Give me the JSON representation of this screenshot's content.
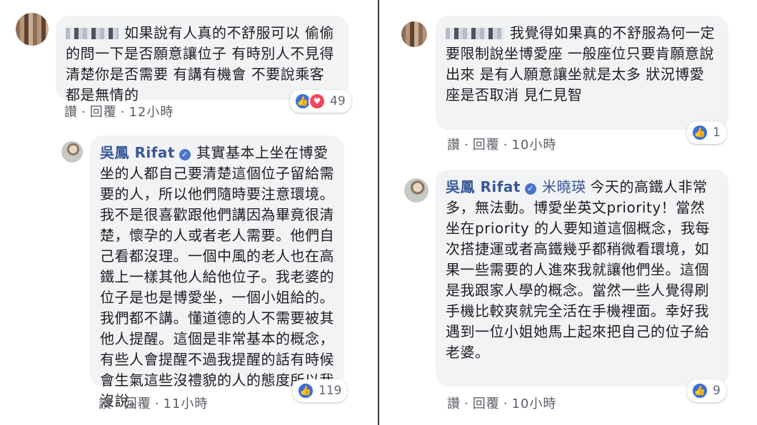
{
  "left_top": {
    "text": "如果說有人真的不舒服可以 偷偷的問一下是否願意讓位子 有時別人不見得清楚你是否需要 有講有機會 不要說乘客都是無情的",
    "like_label": "讚",
    "reply_label": "回覆",
    "time": "12小時",
    "reaction_count": "49",
    "reaction_icons": [
      "like-icon",
      "love-icon"
    ]
  },
  "left_reply": {
    "author": "吳鳳 Rifat",
    "text": "其實基本上坐在博愛坐的人都自己要清楚這個位子留給需要的人，所以他們隨時要注意環境。我不是很喜歡跟他們講因為畢竟很清楚，懷孕的人或者老人需要。他們自己看都沒理。一個中風的老人也在高鐵上一樣其他人給他位子。我老婆的位子是也是博愛坐，一個小姐給的。我們都不講。懂道德的人不需要被其他人提醒。這個是非常基本的概念，有些人會提醒不過我提醒的話有時候會生氣這些沒禮貌的人的態度所以我沒說。",
    "like_label": "讚",
    "reply_label": "回覆",
    "time": "11小時",
    "reaction_count": "119"
  },
  "right_top": {
    "text": "我覺得如果真的不舒服為何一定要限制說坐博愛座 一般座位只要肯願意說出來 是有人願意讓坐就是太多 狀況博愛座是否取消 見仁見智",
    "like_label": "讚",
    "reply_label": "回覆",
    "time": "10小時",
    "reaction_count": "1"
  },
  "right_reply": {
    "author": "吳鳳 Rifat",
    "mention": "米曉瑛",
    "text": "今天的高鐵人非常多，無法動。博愛坐英文priority！當然坐在priority 的人要知道這個概念，我每次搭捷運或者高鐵幾乎都稍微看環境，如果一些需要的人進來我就讓他們坐。這個是我跟家人學的概念。當然一些人覺得刷手機比較爽就完全活在手機裡面。幸好我遇到一位小姐她馬上起來把自己的位子給老婆。",
    "like_label": "讚",
    "reply_label": "回覆",
    "time": "10小時",
    "reaction_count": "9"
  },
  "colors": {
    "bubble_bg": "#f2f3f5",
    "author_link": "#385898",
    "like_blue": "#3b6fd6",
    "love_red": "#f0475d",
    "meta_gray": "#5b5f66"
  }
}
